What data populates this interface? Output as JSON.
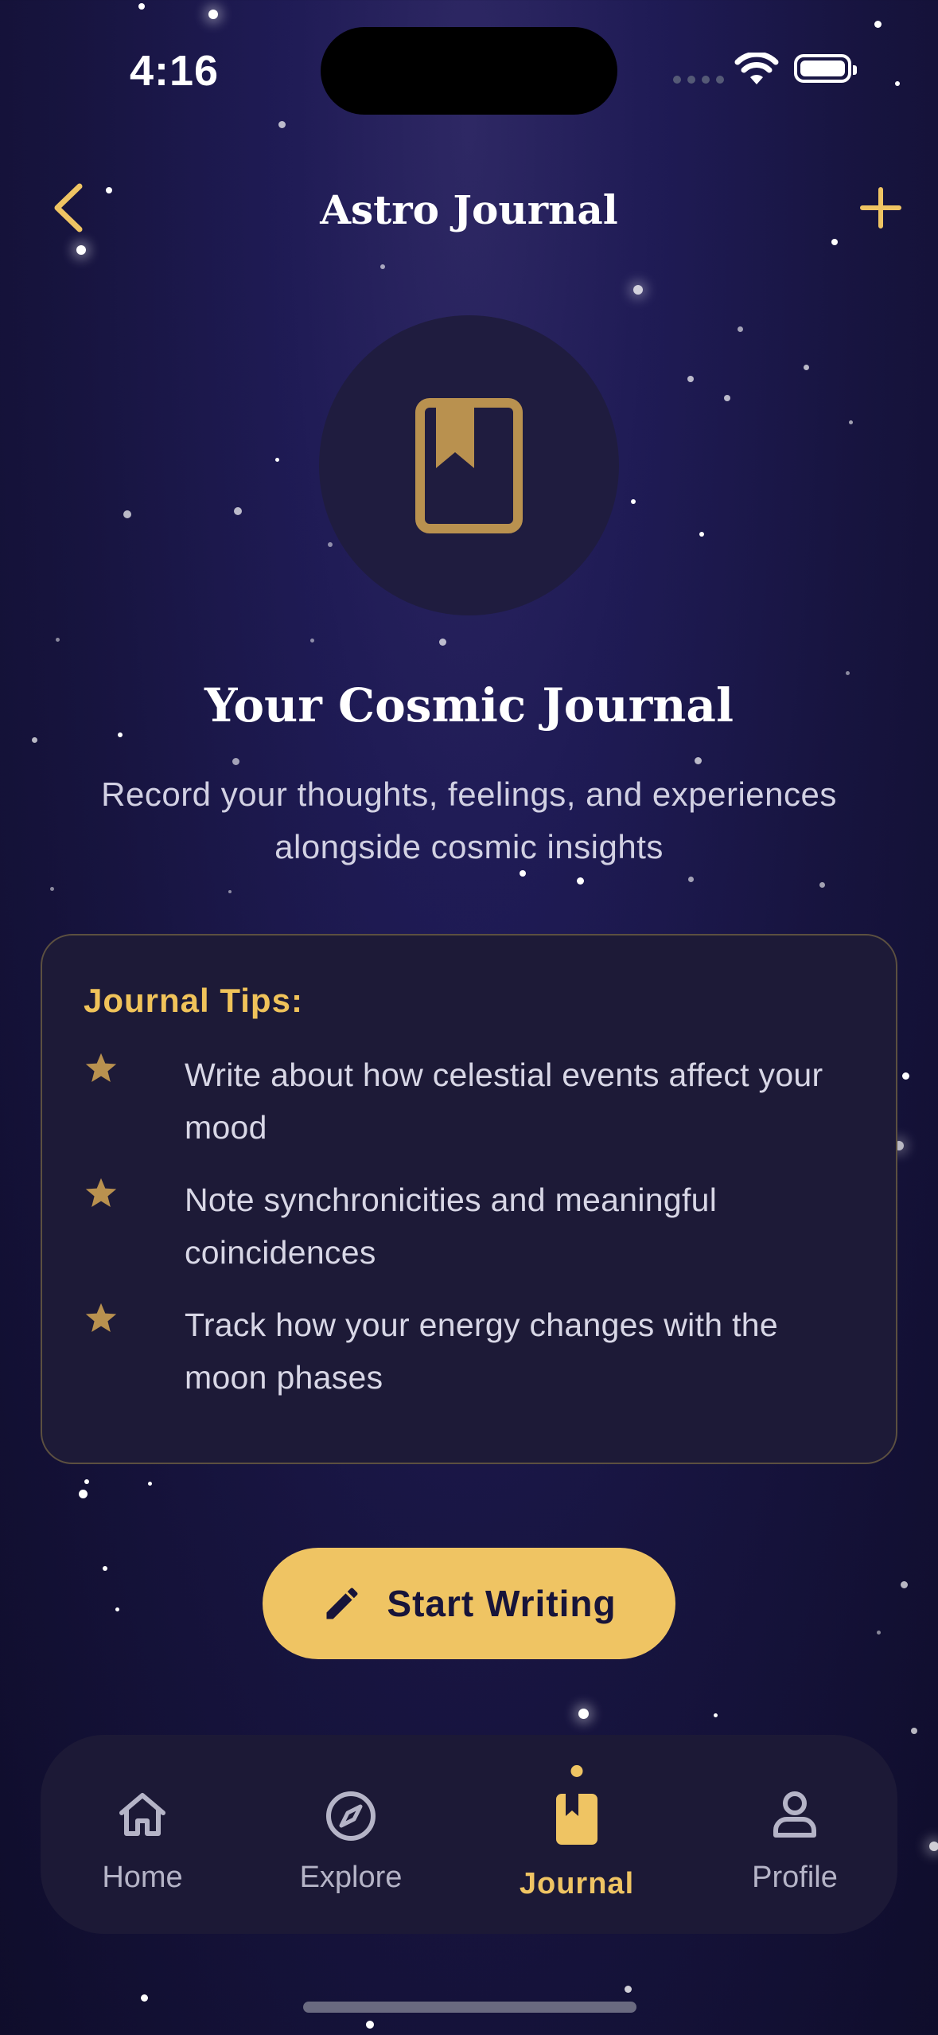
{
  "status_bar": {
    "time": "4:16"
  },
  "header": {
    "title": "Astro Journal",
    "back_icon": "chevron-left-icon",
    "add_icon": "plus-icon"
  },
  "hero": {
    "icon": "bookmark-book-icon",
    "title": "Your Cosmic Journal",
    "subtitle": "Record your thoughts, feelings, and experiences alongside cosmic insights"
  },
  "tips": {
    "title": "Journal Tips:",
    "items": [
      "Write about how celestial events affect your mood",
      "Note synchronicities and meaningful coincidences",
      "Track how your energy changes with the moon phases"
    ]
  },
  "cta": {
    "label": "Start Writing",
    "icon": "pencil-icon"
  },
  "tabbar": {
    "items": [
      {
        "label": "Home",
        "icon": "home-icon"
      },
      {
        "label": "Explore",
        "icon": "compass-icon"
      },
      {
        "label": "Journal",
        "icon": "journal-icon",
        "active": true
      },
      {
        "label": "Profile",
        "icon": "person-icon"
      }
    ]
  },
  "colors": {
    "accent": "#efc463",
    "background": "#1a1746",
    "card": "#1d1a37"
  }
}
